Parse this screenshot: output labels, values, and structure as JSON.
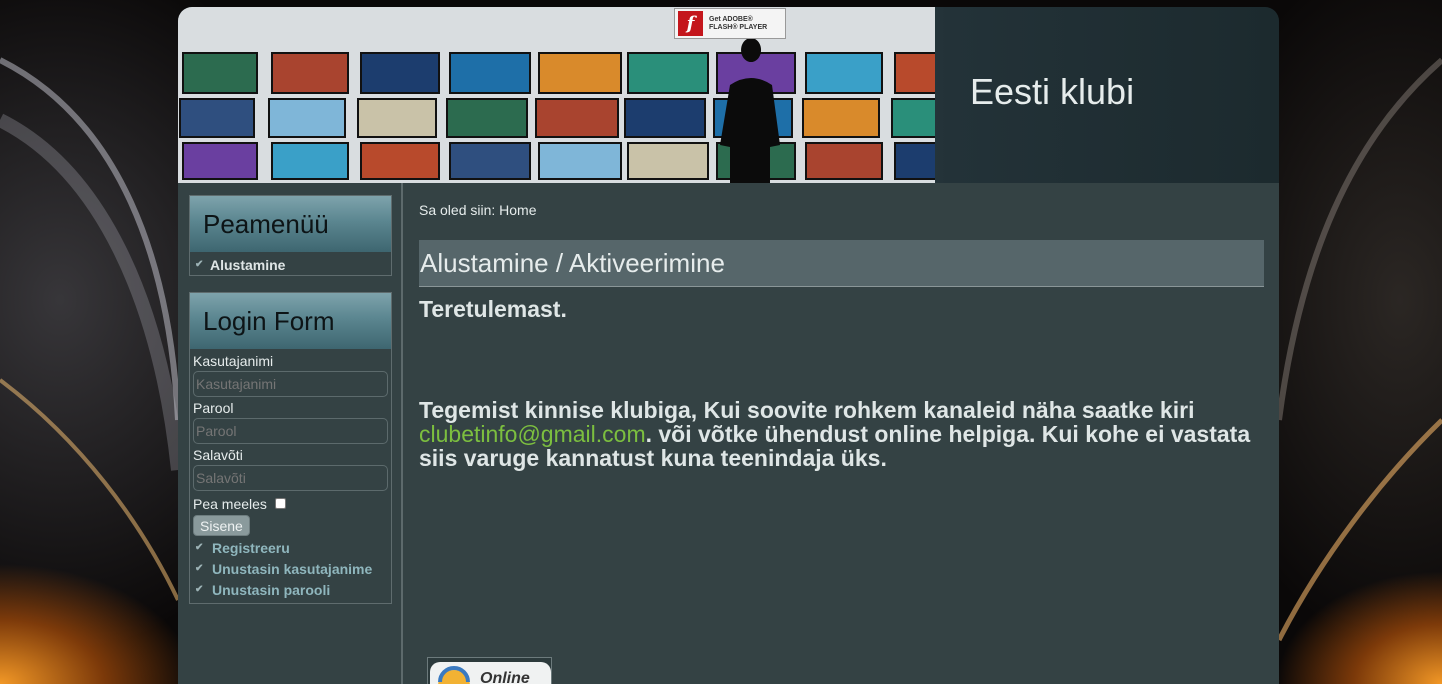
{
  "header": {
    "site_title": "Eesti klubi",
    "flash_badge": {
      "line1": "Get ADOBE®",
      "line2": "FLASH® PLAYER",
      "icon": "flash-icon"
    }
  },
  "sidebar": {
    "main_menu": {
      "title": "Peamenüü",
      "items": [
        {
          "label": "Alustamine",
          "icon": "check-icon"
        }
      ]
    },
    "login": {
      "title": "Login Form",
      "username_label": "Kasutajanimi",
      "username_placeholder": "Kasutajanimi",
      "password_label": "Parool",
      "password_placeholder": "Parool",
      "secret_label": "Salavõti",
      "secret_placeholder": "Salavõti",
      "remember_label": "Pea meeles",
      "submit_label": "Sisene",
      "links": [
        {
          "label": "Registreeru"
        },
        {
          "label": "Unustasin kasutajanime"
        },
        {
          "label": "Unustasin parooli"
        }
      ]
    }
  },
  "content": {
    "breadcrumb": "Sa oled siin: Home",
    "heading": "Alustamine / Aktiveerimine",
    "welcome": "Teretulemast.",
    "message_part1": "Tegemist kinnise klubiga, Kui soovite rohkem kanaleid näha  saatke kiri ",
    "email": "clubetinfo@gmail.com",
    "message_part2": ". või võtke ühendust online helpiga. Kui kohe ei vastata siis varuge kannatust kuna teenindaja üks.",
    "online_widget_label": "Online"
  },
  "colors": {
    "body_bg": "#344244",
    "module_head": "#5b8690",
    "email_link": "#7cbf3f",
    "heading_bar": "#56666a"
  }
}
